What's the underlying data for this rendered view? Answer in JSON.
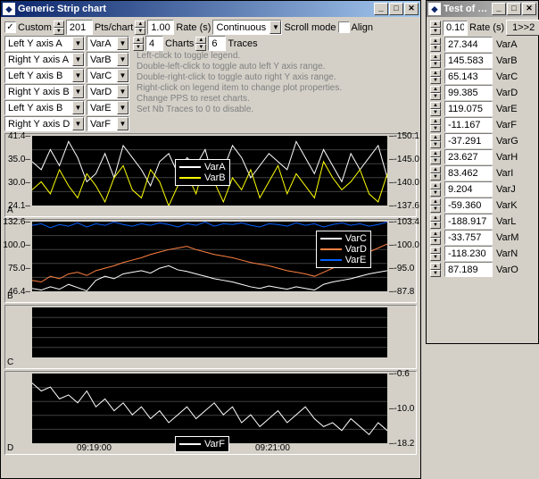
{
  "main_window": {
    "title": "Generic Strip chart",
    "custom_label": "Custom",
    "pts_value": "201",
    "pts_label": "Pts/chart",
    "rate_value": "1.00",
    "rate_label": "Rate (s)",
    "mode_value": "Continuous",
    "scroll_label": "Scroll mode",
    "align_label": "Align",
    "charts_value": "4",
    "charts_label": "Charts",
    "traces_value": "6",
    "traces_label": "Traces",
    "axis_selectors": [
      {
        "axis": "Left Y axis A",
        "var": "VarA"
      },
      {
        "axis": "Right Y axis A",
        "var": "VarB"
      },
      {
        "axis": "Left Y axis B",
        "var": "VarC"
      },
      {
        "axis": "Right Y axis B",
        "var": "VarD"
      },
      {
        "axis": "Left Y axis B",
        "var": "VarE"
      },
      {
        "axis": "Right Y axis D",
        "var": "VarF"
      }
    ],
    "help": [
      "Left-click to toggle legend.",
      "Double-left-click to toggle auto left Y axis range.",
      "Double-right-click to toggle auto right Y axis range.",
      "Right-click on legend item to change plot properties.",
      "Change PPS to reset charts.",
      "Set Nb Traces to 0 to disable."
    ]
  },
  "chart_data": [
    {
      "type": "line",
      "label": "A",
      "left_ticks": [
        "41.4",
        "35.0",
        "30.0",
        "24.1"
      ],
      "right_ticks": [
        "-150.1",
        "-145.0",
        "-140.0",
        "-137.6"
      ],
      "legend_pos": "center",
      "series": [
        {
          "name": "VarA",
          "color": "#ffffff",
          "values": [
            35,
            33,
            38,
            34,
            40,
            36,
            30,
            32,
            37,
            31,
            39,
            36,
            33,
            29,
            35,
            37,
            32,
            36,
            34,
            38,
            30,
            33,
            39,
            36,
            31,
            34,
            37,
            35,
            33,
            40,
            36,
            32,
            38,
            34,
            30,
            37,
            33,
            36,
            39,
            31
          ]
        },
        {
          "name": "VarB",
          "color": "#ffff00",
          "values": [
            28,
            30,
            27,
            33,
            29,
            26,
            32,
            29,
            25,
            31,
            34,
            28,
            26,
            33,
            30,
            24,
            29,
            32,
            27,
            35,
            30,
            25,
            31,
            28,
            33,
            26,
            30,
            34,
            27,
            32,
            29,
            26,
            35,
            31,
            28,
            30,
            33,
            27,
            25,
            32
          ]
        }
      ],
      "ylim_left": [
        24.1,
        41.4
      ],
      "ylim_right": [
        -150.1,
        -137.6
      ]
    },
    {
      "type": "line",
      "label": "B",
      "left_ticks": [
        "132.6",
        "100.0",
        "75.0",
        "46.4"
      ],
      "right_ticks": [
        "-103.4",
        "-100.0",
        "-95.0",
        "-87.8"
      ],
      "legend_pos": "right",
      "series": [
        {
          "name": "VarC",
          "color": "#ffffff",
          "values": [
            50,
            48,
            52,
            49,
            55,
            51,
            47,
            60,
            65,
            62,
            68,
            70,
            72,
            69,
            75,
            78,
            73,
            71,
            68,
            65,
            62,
            60,
            58,
            55,
            52,
            50,
            53,
            51,
            49,
            52,
            50,
            48,
            55,
            58,
            60,
            62,
            65,
            68,
            70,
            72
          ]
        },
        {
          "name": "VarD",
          "color": "#ff8040",
          "values": [
            60,
            58,
            65,
            62,
            68,
            70,
            66,
            72,
            75,
            78,
            82,
            85,
            88,
            92,
            95,
            98,
            100,
            102,
            98,
            95,
            92,
            90,
            88,
            85,
            82,
            80,
            78,
            75,
            72,
            70,
            68,
            65,
            70,
            75,
            80,
            85,
            90,
            95,
            100,
            105
          ]
        },
        {
          "name": "VarE",
          "color": "#0060ff",
          "values": [
            128,
            130,
            125,
            129,
            127,
            131,
            126,
            130,
            128,
            132,
            129,
            127,
            130,
            128,
            131,
            129,
            126,
            130,
            128,
            132,
            127,
            130,
            129,
            131,
            128,
            126,
            130,
            129,
            127,
            131,
            128,
            130,
            126,
            129,
            131,
            128,
            130,
            127,
            129,
            132
          ]
        }
      ],
      "ylim_left": [
        46.4,
        132.6
      ],
      "ylim_right": [
        -103.4,
        -87.8
      ]
    },
    {
      "type": "line",
      "label": "C",
      "left_ticks": [],
      "right_ticks": [],
      "series": [],
      "empty": true
    },
    {
      "type": "line",
      "label": "D",
      "left_ticks": [],
      "right_ticks": [
        "-0.6",
        "-10.0",
        "-18.2"
      ],
      "x_ticks": [
        "09:19:00",
        "09:21:00"
      ],
      "legend_pos": "center-bottom",
      "series": [
        {
          "name": "VarF",
          "color": "#ffffff",
          "values": [
            -3,
            -5,
            -4,
            -7,
            -6,
            -8,
            -5,
            -9,
            -7,
            -10,
            -8,
            -11,
            -9,
            -12,
            -10,
            -13,
            -11,
            -9,
            -12,
            -10,
            -8,
            -11,
            -9,
            -13,
            -11,
            -14,
            -12,
            -10,
            -13,
            -11,
            -9,
            -12,
            -14,
            -13,
            -15,
            -12,
            -14,
            -16,
            -13,
            -15
          ]
        }
      ],
      "ylim_right": [
        -18.2,
        -0.6
      ]
    }
  ],
  "side_window": {
    "title": "Test of Gene...",
    "rate_value": "0.10",
    "rate_label": "Rate (s)",
    "btn_label": "1>>2",
    "vars": [
      {
        "value": "27.344",
        "name": "VarA"
      },
      {
        "value": "145.583",
        "name": "VarB"
      },
      {
        "value": "65.143",
        "name": "VarC"
      },
      {
        "value": "99.385",
        "name": "VarD"
      },
      {
        "value": "119.075",
        "name": "VarE"
      },
      {
        "value": "-11.167",
        "name": "VarF"
      },
      {
        "value": "-37.291",
        "name": "VarG"
      },
      {
        "value": "23.627",
        "name": "VarH"
      },
      {
        "value": "83.462",
        "name": "VarI"
      },
      {
        "value": "9.204",
        "name": "VarJ"
      },
      {
        "value": "-59.360",
        "name": "VarK"
      },
      {
        "value": "-188.917",
        "name": "VarL"
      },
      {
        "value": "-33.757",
        "name": "VarM"
      },
      {
        "value": "-118.230",
        "name": "VarN"
      },
      {
        "value": "87.189",
        "name": "VarO"
      }
    ]
  }
}
